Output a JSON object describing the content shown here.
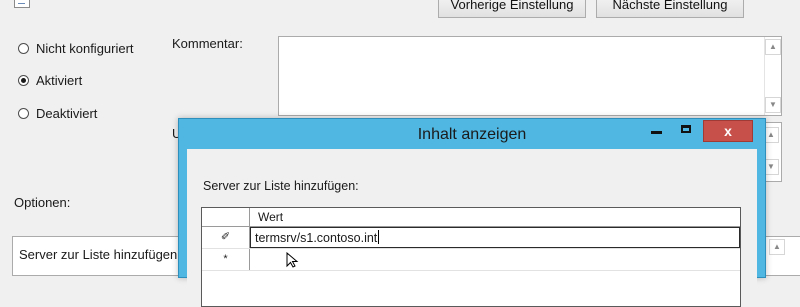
{
  "header": {
    "prev_button": "Vorherige Einstellung",
    "next_button": "Nächste Einstellung"
  },
  "state": {
    "options": [
      {
        "label": "Nicht konfiguriert",
        "checked": false
      },
      {
        "label": "Aktiviert",
        "checked": true
      },
      {
        "label": "Deaktiviert",
        "checked": false
      }
    ]
  },
  "comment": {
    "label": "Kommentar:",
    "value": ""
  },
  "partial_label": "U",
  "options_section": {
    "label": "Optionen:",
    "row_text": "Server zur Liste hinzufügen"
  },
  "modal": {
    "title": "Inhalt anzeigen",
    "instruction": "Server zur Liste hinzufügen:",
    "close_glyph": "x",
    "grid": {
      "column_header": "Wert",
      "rows": [
        {
          "marker": "edit-pencil-icon",
          "marker_glyph": "✐",
          "value": "termsrv/s1.contoso.int",
          "editing": true
        },
        {
          "marker": "new-row-asterisk-icon",
          "marker_glyph": "*",
          "value": "",
          "editing": false
        }
      ]
    }
  },
  "icons": {
    "cursor": "mouse-pointer-icon"
  },
  "colors": {
    "window_frame": "#4fb7e1",
    "close_button": "#c7504a",
    "background": "#f0f0f0"
  }
}
